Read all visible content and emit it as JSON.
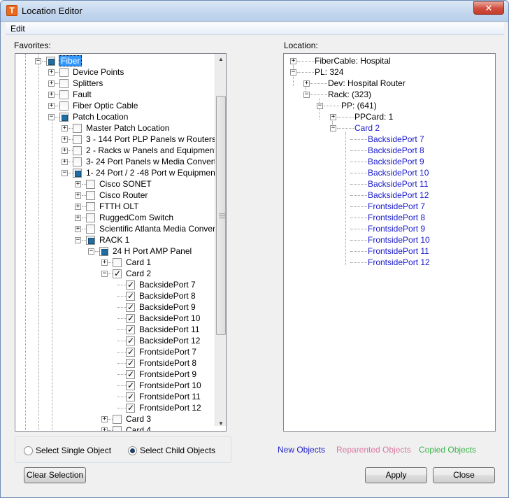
{
  "window": {
    "title": "Location Editor",
    "icon_letter": "T",
    "close_glyph": "✕"
  },
  "menu": {
    "edit": "Edit"
  },
  "favorites": {
    "label": "Favorites:",
    "items": [
      {
        "label": "Fiber",
        "state": "partial",
        "exp": "−",
        "selected": true
      },
      {
        "label": "Device Points",
        "state": "none",
        "exp": "+"
      },
      {
        "label": "Splitters",
        "state": "none",
        "exp": "+"
      },
      {
        "label": "Fault",
        "state": "none",
        "exp": "+"
      },
      {
        "label": "Fiber Optic Cable",
        "state": "none",
        "exp": "+"
      },
      {
        "label": "Patch Location",
        "state": "partial",
        "exp": "−"
      },
      {
        "label": "Master Patch Location",
        "state": "none",
        "exp": "+"
      },
      {
        "label": "3 - 144 Port PLP Panels w Routers",
        "state": "none",
        "exp": "+"
      },
      {
        "label": "2 - Racks w Panels and Equipment",
        "state": "none",
        "exp": "+"
      },
      {
        "label": "3- 24 Port Panels w Media Converters",
        "state": "none",
        "exp": "+"
      },
      {
        "label": "1- 24 Port / 2 -48 Port w Equipment",
        "state": "partial",
        "exp": "−"
      },
      {
        "label": "Cisco SONET",
        "state": "none",
        "exp": "+"
      },
      {
        "label": "Cisco Router",
        "state": "none",
        "exp": "+"
      },
      {
        "label": "FTTH OLT",
        "state": "none",
        "exp": "+"
      },
      {
        "label": "RuggedCom Switch",
        "state": "none",
        "exp": "+"
      },
      {
        "label": "Scientific Atlanta Media Converter",
        "state": "none",
        "exp": "+"
      },
      {
        "label": "RACK 1",
        "state": "partial",
        "exp": "−"
      },
      {
        "label": "24 H Port AMP Panel",
        "state": "partial",
        "exp": "−"
      },
      {
        "label": "Card 1",
        "state": "none",
        "exp": "+"
      },
      {
        "label": "Card 2",
        "state": "checked",
        "exp": "−"
      },
      {
        "label": "BacksidePort 7",
        "state": "checked",
        "exp": ""
      },
      {
        "label": "BacksidePort 8",
        "state": "checked",
        "exp": ""
      },
      {
        "label": "BacksidePort 9",
        "state": "checked",
        "exp": ""
      },
      {
        "label": "BacksidePort 10",
        "state": "checked",
        "exp": ""
      },
      {
        "label": "BacksidePort 11",
        "state": "checked",
        "exp": ""
      },
      {
        "label": "BacksidePort 12",
        "state": "checked",
        "exp": ""
      },
      {
        "label": "FrontsidePort 7",
        "state": "checked",
        "exp": ""
      },
      {
        "label": "FrontsidePort 8",
        "state": "checked",
        "exp": ""
      },
      {
        "label": "FrontsidePort 9",
        "state": "checked",
        "exp": ""
      },
      {
        "label": "FrontsidePort 10",
        "state": "checked",
        "exp": ""
      },
      {
        "label": "FrontsidePort 11",
        "state": "checked",
        "exp": ""
      },
      {
        "label": "FrontsidePort 12",
        "state": "checked",
        "exp": ""
      },
      {
        "label": "Card 3",
        "state": "none",
        "exp": "+"
      },
      {
        "label": "Card 4",
        "state": "none",
        "exp": "+"
      }
    ]
  },
  "location": {
    "label": "Location:",
    "items": [
      {
        "label": "FiberCable: Hospital",
        "exp": "+",
        "color": "black"
      },
      {
        "label": "PL: 324",
        "exp": "−",
        "color": "black"
      },
      {
        "label": "Dev: Hospital Router",
        "exp": "+",
        "color": "black"
      },
      {
        "label": "Rack: (323)",
        "exp": "−",
        "color": "black"
      },
      {
        "label": "PP: (641)",
        "exp": "−",
        "color": "black"
      },
      {
        "label": "PPCard: 1",
        "exp": "+",
        "color": "black"
      },
      {
        "label": "Card 2",
        "exp": "−",
        "color": "blue"
      },
      {
        "label": "BacksidePort 7",
        "exp": "",
        "color": "blue"
      },
      {
        "label": "BacksidePort 8",
        "exp": "",
        "color": "blue"
      },
      {
        "label": "BacksidePort 9",
        "exp": "",
        "color": "blue"
      },
      {
        "label": "BacksidePort 10",
        "exp": "",
        "color": "blue"
      },
      {
        "label": "BacksidePort 11",
        "exp": "",
        "color": "blue"
      },
      {
        "label": "BacksidePort 12",
        "exp": "",
        "color": "blue"
      },
      {
        "label": "FrontsidePort 7",
        "exp": "",
        "color": "blue"
      },
      {
        "label": "FrontsidePort 8",
        "exp": "",
        "color": "blue"
      },
      {
        "label": "FrontsidePort 9",
        "exp": "",
        "color": "blue"
      },
      {
        "label": "FrontsidePort 10",
        "exp": "",
        "color": "blue"
      },
      {
        "label": "FrontsidePort 11",
        "exp": "",
        "color": "blue"
      },
      {
        "label": "FrontsidePort 12",
        "exp": "",
        "color": "blue"
      }
    ]
  },
  "selection_mode": {
    "single": "Select Single Object",
    "child": "Select Child Objects",
    "selected": "child"
  },
  "legend": {
    "new": {
      "label": "New Objects",
      "color": "#2323c8"
    },
    "reparented": {
      "label": "Reparented Objects",
      "color": "#d77aa0"
    },
    "copied": {
      "label": "Copied Objects",
      "color": "#3cb44b"
    }
  },
  "buttons": {
    "clear": "Clear Selection",
    "apply": "Apply",
    "close": "Close"
  },
  "colors": {
    "selection": "#3399ff",
    "new_object_text": "#1a1acc"
  }
}
